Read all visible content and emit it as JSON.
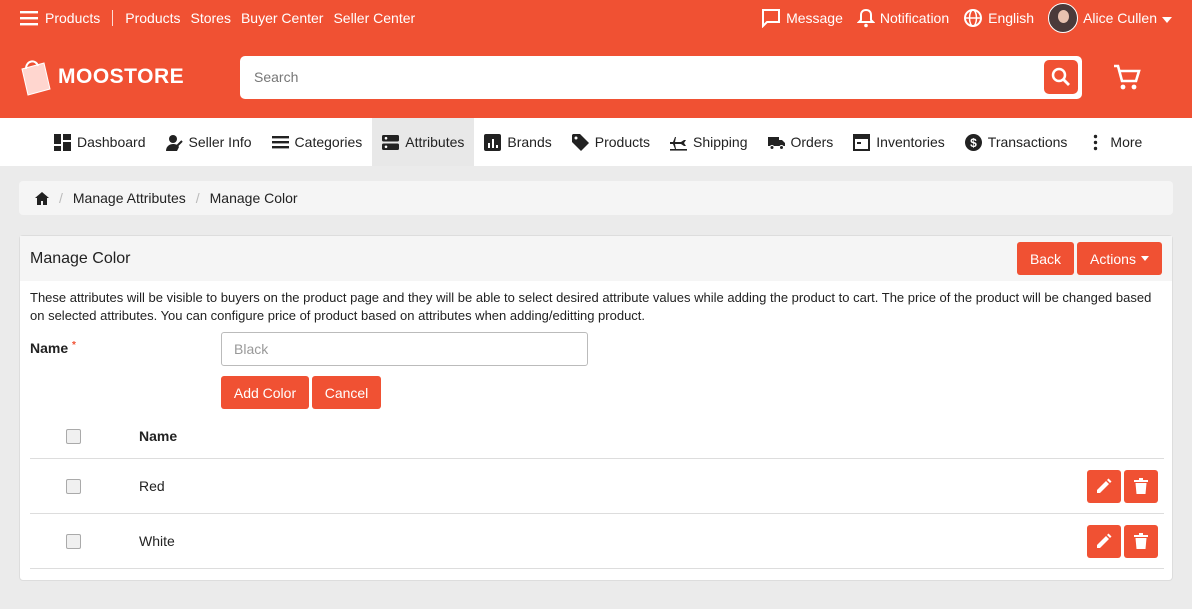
{
  "topline": {
    "menu_label": "Products",
    "links": [
      "Products",
      "Stores",
      "Buyer Center",
      "Seller Center"
    ],
    "message": "Message",
    "notification": "Notification",
    "language": "English",
    "user": "Alice Cullen"
  },
  "brand": {
    "name": "MOOSTORE"
  },
  "search": {
    "placeholder": "Search"
  },
  "nav": [
    {
      "label": "Dashboard",
      "icon": "dashboard-icon"
    },
    {
      "label": "Seller Info",
      "icon": "user-info-icon"
    },
    {
      "label": "Categories",
      "icon": "list-icon"
    },
    {
      "label": "Attributes",
      "icon": "attributes-icon",
      "active": true
    },
    {
      "label": "Brands",
      "icon": "chart-icon"
    },
    {
      "label": "Products",
      "icon": "tag-icon"
    },
    {
      "label": "Shipping",
      "icon": "plane-icon"
    },
    {
      "label": "Orders",
      "icon": "truck-icon"
    },
    {
      "label": "Inventories",
      "icon": "inventory-icon"
    },
    {
      "label": "Transactions",
      "icon": "dollar-icon"
    },
    {
      "label": "More",
      "icon": "more-vertical-icon"
    }
  ],
  "breadcrumb": [
    "Manage Attributes",
    "Manage Color"
  ],
  "panel": {
    "title": "Manage Color",
    "back_label": "Back",
    "actions_label": "Actions",
    "description": "These attributes will be visible to buyers on the product page and they will be able to select desired attribute values while adding the product to cart. The price of the product will be changed based on selected attributes. You can configure price of product based on attributes when adding/editting product.",
    "form": {
      "name_label": "Name",
      "required_mark": "*",
      "name_placeholder": "Black",
      "add_label": "Add Color",
      "cancel_label": "Cancel"
    },
    "table": {
      "header": "Name",
      "rows": [
        "Red",
        "White"
      ]
    }
  },
  "colors": {
    "accent": "#f05133",
    "nav_active": "#e8e8e8"
  }
}
